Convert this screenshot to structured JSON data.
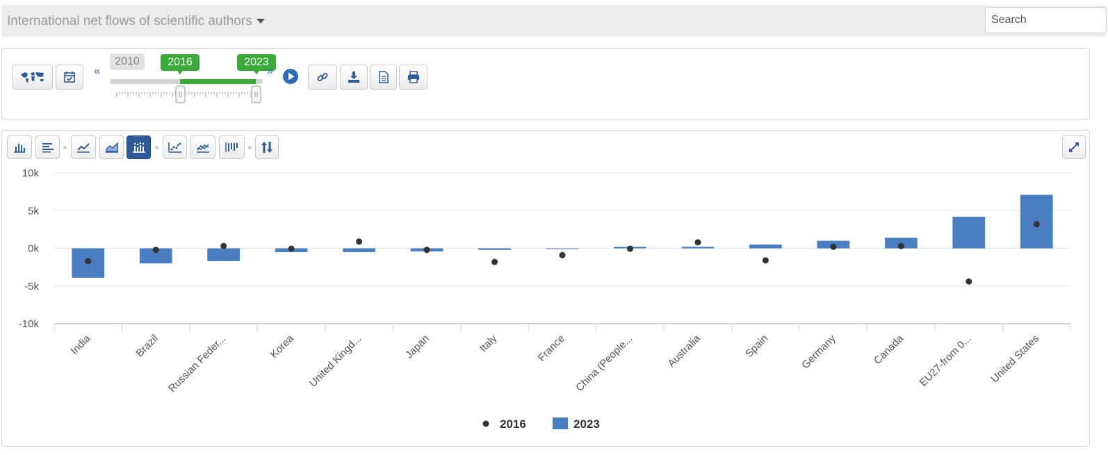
{
  "header": {
    "title": "International net flows of scientific authors",
    "search_placeholder": "Search"
  },
  "timeline": {
    "start_year": "2010",
    "from_year": "2016",
    "to_year": "2023",
    "prev_label": "«",
    "next_label": "»",
    "min_year": 2010,
    "max_year": 2023
  },
  "toolbar_icons": [
    "world-map-icon",
    "calendar-icon",
    "play-icon",
    "link-icon",
    "download-icon",
    "document-icon",
    "print-icon"
  ],
  "chart_toolbar_icons": [
    "bar-chart-icon",
    "horizontal-bar-icon",
    "line-chart-icon",
    "area-chart-icon",
    "bar-dot-chart-icon",
    "scatter-icon",
    "line-scatter-icon",
    "stacked-bar-icon",
    "sort-icon",
    "expand-icon"
  ],
  "colors": {
    "bar": "#4a7ec2",
    "dot": "#333333",
    "active": "#2d5a9a",
    "green": "#3aab3a"
  },
  "chart_data": {
    "type": "bar",
    "categories": [
      "India",
      "Brazil",
      "Russian Feder...",
      "Korea",
      "United Kingd...",
      "Japan",
      "Italy",
      "France",
      "China (People...",
      "Australia",
      "Spain",
      "Germany",
      "Canada",
      "EU27-from 0...",
      "United States"
    ],
    "series": [
      {
        "name": "2016",
        "type": "scatter",
        "values": [
          -1700,
          -200,
          300,
          -50,
          900,
          -200,
          -1800,
          -900,
          -50,
          800,
          -1600,
          200,
          300,
          -4400,
          3200
        ]
      },
      {
        "name": "2023",
        "type": "bar",
        "values": [
          -3900,
          -2000,
          -1700,
          -500,
          -500,
          -400,
          -200,
          0,
          200,
          200,
          500,
          1000,
          1400,
          4200,
          7100
        ]
      }
    ],
    "yticks": [
      "10k",
      "5k",
      "0k",
      "-5k",
      "-10k"
    ],
    "ytick_values": [
      10000,
      5000,
      0,
      -5000,
      -10000
    ],
    "ylim": [
      -10000,
      10000
    ],
    "legend": [
      "2016",
      "2023"
    ],
    "legend_position": "bottom",
    "grid": true
  }
}
